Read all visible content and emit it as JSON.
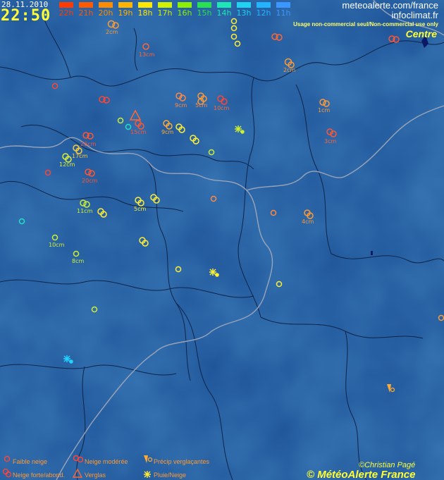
{
  "header": {
    "date": "28.11.2010",
    "time": "22:50",
    "site1": "meteoalerte.com/france",
    "site2": "infoclimat.fr",
    "usage": "Usage non-commercial seul/Non-commercial use only",
    "region": "Centre"
  },
  "hours": [
    {
      "label": "22h",
      "color": "#ff3b00"
    },
    {
      "label": "21h",
      "color": "#ff5a00"
    },
    {
      "label": "20h",
      "color": "#ff8c00"
    },
    {
      "label": "19h",
      "color": "#ffb400"
    },
    {
      "label": "18h",
      "color": "#ffe600"
    },
    {
      "label": "17h",
      "color": "#d2f000"
    },
    {
      "label": "16h",
      "color": "#8cf000"
    },
    {
      "label": "15h",
      "color": "#28e050"
    },
    {
      "label": "14h",
      "color": "#1ee6b4"
    },
    {
      "label": "13h",
      "color": "#1ed2f0"
    },
    {
      "label": "12h",
      "color": "#22b4ff"
    },
    {
      "label": "11h",
      "color": "#3c96ff"
    }
  ],
  "accumulations": [
    {
      "text": "2cm",
      "color": "#ff9933"
    },
    {
      "text": "13cm",
      "color": "#ff6633"
    },
    {
      "text": "2cm",
      "color": "#ff9933"
    },
    {
      "text": "9cm",
      "color": "#ff8844"
    },
    {
      "text": "5cm",
      "color": "#ff8844"
    },
    {
      "text": "10cm",
      "color": "#ff6633"
    },
    {
      "text": "1cm",
      "color": "#ff9933"
    },
    {
      "text": "15cm",
      "color": "#ff5533"
    },
    {
      "text": "9cm",
      "color": "#ffaa33"
    },
    {
      "text": "3cm",
      "color": "#ff6633"
    },
    {
      "text": "26cm",
      "color": "#ff5533"
    },
    {
      "text": "17cm",
      "color": "#ffcc33"
    },
    {
      "text": "12cm",
      "color": "#ddee33"
    },
    {
      "text": "20cm",
      "color": "#ff5533"
    },
    {
      "text": "11cm",
      "color": "#ccee33"
    },
    {
      "text": "5cm",
      "color": "#ffee33"
    },
    {
      "text": "4cm",
      "color": "#ff9933"
    },
    {
      "text": "10cm",
      "color": "#ccee33"
    },
    {
      "text": "8cm",
      "color": "#ccee33"
    }
  ],
  "legend": [
    {
      "label": "Faible neige",
      "icon": "light-snow-icon"
    },
    {
      "label": "Neige modérée",
      "icon": "moderate-snow-icon"
    },
    {
      "label": "Précip verglaçantes",
      "icon": "freezing-precip-icon"
    },
    {
      "label": "Neige forte/abond.",
      "icon": "heavy-snow-icon"
    },
    {
      "label": "Verglas",
      "icon": "ice-warning-icon"
    },
    {
      "label": "Pluie/Neige",
      "icon": "rain-snow-icon"
    }
  ],
  "credits": {
    "author": "©Christian Pagé",
    "brand": "© MétéoAlerte France"
  }
}
